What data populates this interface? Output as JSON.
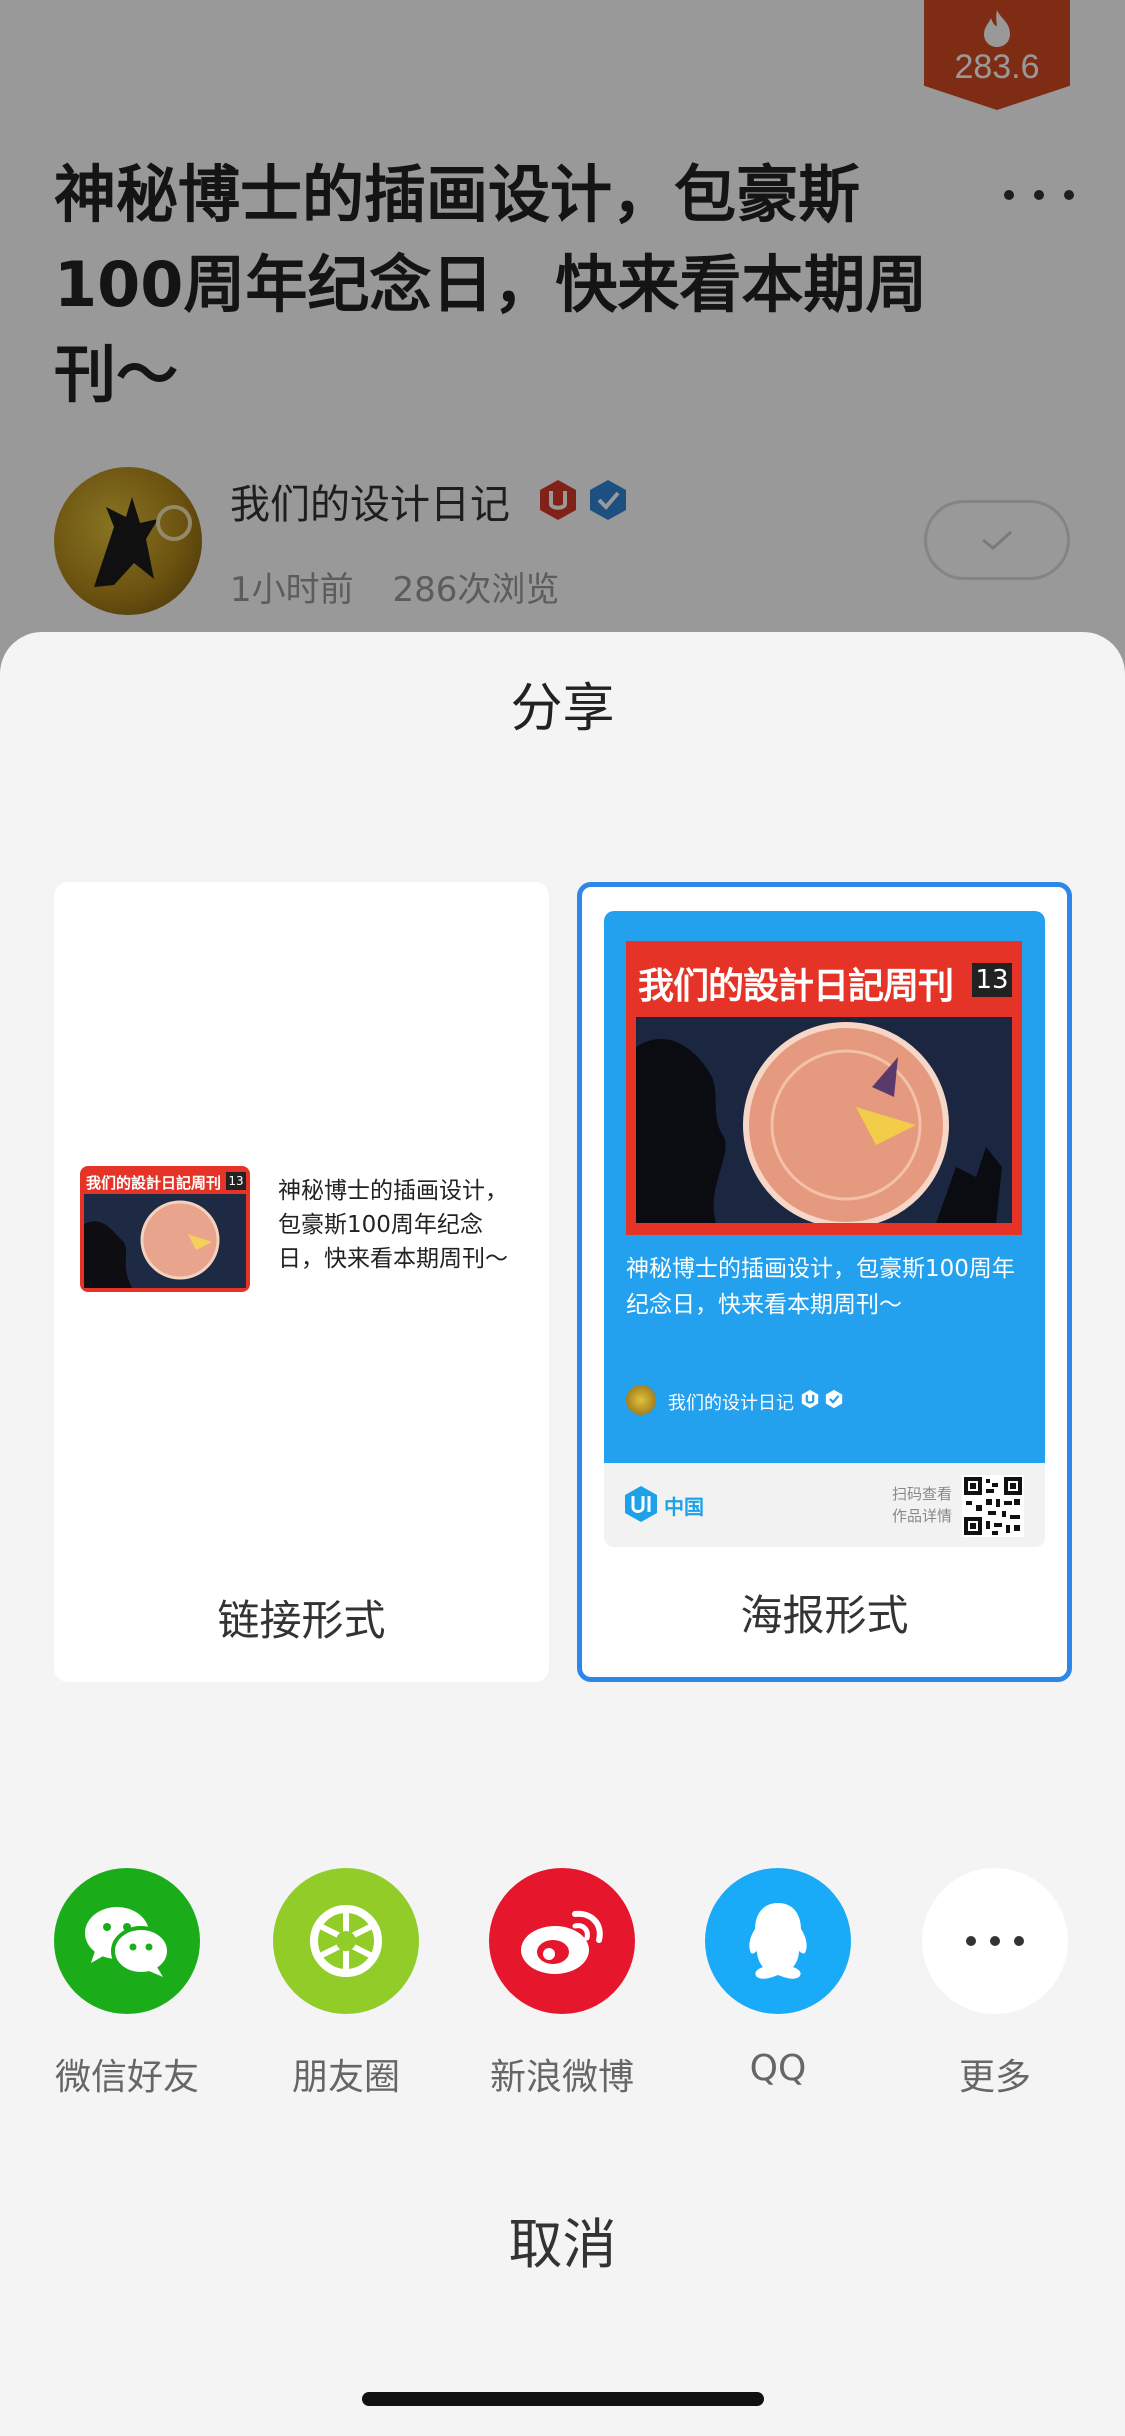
{
  "article": {
    "hot_score": "283.6",
    "title": "神秘博士的插画设计，包豪斯100周年纪念日，快来看本期周刊～",
    "author": "我们的设计日记",
    "time_ago": "1小时前",
    "views": "286次浏览"
  },
  "share": {
    "title": "分享",
    "link_card": {
      "label": "链接形式",
      "thumb_banner": "我们的設計日記周刊",
      "thumb_number": "13",
      "text": "神秘博士的插画设计，包豪斯100周年纪念日，快来看本期周刊～"
    },
    "poster_card": {
      "label": "海报形式",
      "banner": "我们的設計日記周刊",
      "number": "13",
      "text": "神秘博士的插画设计，包豪斯100周年纪念日，快来看本期周刊～",
      "author": "我们的设计日记",
      "logo_text": "中国",
      "scan_text": "扫码查看作品详情"
    },
    "targets": [
      {
        "label": "微信好友",
        "icon": "wechat-icon",
        "color": "#1aad19"
      },
      {
        "label": "朋友圈",
        "icon": "moments-icon",
        "color": "#91cc28"
      },
      {
        "label": "新浪微博",
        "icon": "weibo-icon",
        "color": "#e6162d"
      },
      {
        "label": "QQ",
        "icon": "qq-icon",
        "color": "#19aaf8"
      },
      {
        "label": "更多",
        "icon": "more-icon",
        "color": "#ffffff"
      }
    ],
    "cancel": "取消"
  },
  "colors": {
    "selected_border": "#2e86e8",
    "poster_bg": "#24a1ee",
    "cover_red": "#e53427",
    "hot_badge": "#d24b22"
  }
}
